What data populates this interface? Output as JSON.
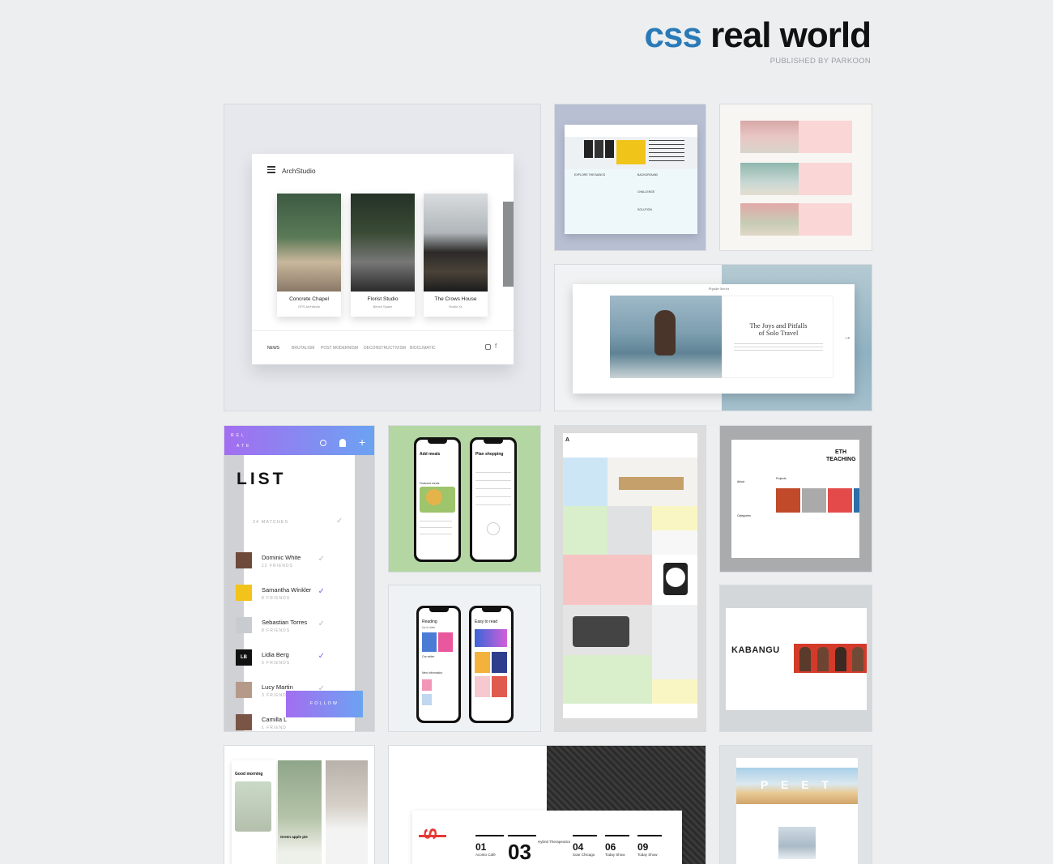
{
  "header": {
    "logo_part1": "css",
    "logo_part2": "real world",
    "byline": "PUBLISHED BY PARKOON"
  },
  "colors": {
    "accent": "#2a7ab8",
    "background": "#eceeef"
  },
  "tiles": {
    "arch": {
      "brand": "ArchStudio",
      "cards": [
        {
          "title": "Concrete Chapel",
          "sub": "OPS Architects"
        },
        {
          "title": "Florist Studio",
          "sub": "Bench Space"
        },
        {
          "title": "The Crows House",
          "sub": "Studio XL"
        }
      ],
      "nav": [
        "NEWS",
        "BRUTALISM",
        "POST MODERNISM",
        "DECONSTRUCTIVISM",
        "BIOCLIMATIC"
      ]
    },
    "list": {
      "brand_line1": "REL",
      "brand_line2": "ATE",
      "title": "LIST",
      "matches": "24 MATCHES",
      "rows": [
        {
          "name": "Dominic White",
          "sub": "12 FRIENDS"
        },
        {
          "name": "Samantha Winkler",
          "sub": "8 FRIENDS"
        },
        {
          "name": "Sebastian Torres",
          "sub": "8 FRIENDS"
        },
        {
          "name": "Lidia Berg",
          "sub": "5 FRIENDS",
          "initials": "LB"
        },
        {
          "name": "Lucy Martin",
          "sub": "3 FRIENDS"
        },
        {
          "name": "Camilla L",
          "sub": "1 FRIEND"
        }
      ],
      "follow": "FOLLOW"
    },
    "meals": {
      "left_title": "Add meals",
      "right_title": "Plan shopping",
      "featured": "Featured meals"
    },
    "reading": {
      "left_title": "Reading",
      "left_sub": "Up to date",
      "right_title": "Easy to read",
      "our_writer": "Our writer",
      "new_information": "New information"
    },
    "travel": {
      "title_line1": "The Joys and Pitfalls",
      "title_line2": "of Solo Travel",
      "header": "Popular Stories"
    },
    "arch2": {
      "col1": "EXPLORE THE BASICS",
      "col2": "BACKGROUND",
      "col3": "CHALLENGE",
      "col4": "SOLUTION"
    },
    "eth": {
      "title_line1": "ETH",
      "title_line2": "TEACHING",
      "projects": "Projects",
      "about": "About",
      "categories": "Categories"
    },
    "kabangu": {
      "title": "KABANGU"
    },
    "morning": {
      "greeting": "Good morning",
      "card": "Green apple pie"
    },
    "numbers": {
      "items": [
        {
          "num": "01",
          "label": "Aconto Café"
        },
        {
          "num": "03",
          "label": "Hybrid Therapeutics"
        },
        {
          "num": "04",
          "label": "Soar Chicago"
        },
        {
          "num": "06",
          "label": "Today Show"
        },
        {
          "num": "09",
          "label": "Today Show"
        }
      ]
    },
    "peet": {
      "title": "P E E T"
    }
  }
}
